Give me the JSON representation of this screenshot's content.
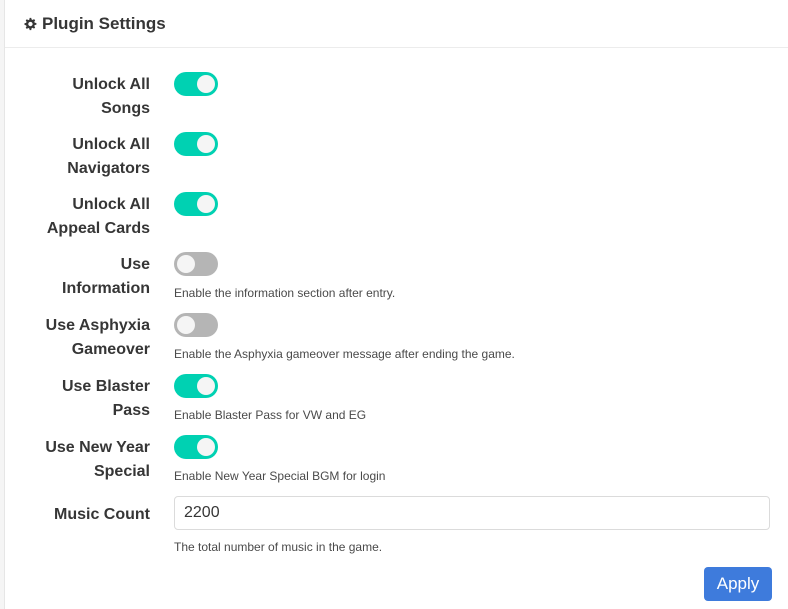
{
  "header": {
    "title": "Plugin Settings",
    "icon": "gear-icon"
  },
  "settings": [
    {
      "label_line1": "Unlock All",
      "label_line2": "Songs",
      "enabled": true,
      "help": ""
    },
    {
      "label_line1": "Unlock All",
      "label_line2": "Navigators",
      "enabled": true,
      "help": ""
    },
    {
      "label_line1": "Unlock All",
      "label_line2": "Appeal Cards",
      "enabled": true,
      "help": ""
    },
    {
      "label_line1": "Use",
      "label_line2": "Information",
      "enabled": false,
      "help": "Enable the information section after entry."
    },
    {
      "label_line1": "Use Asphyxia",
      "label_line2": "Gameover",
      "enabled": false,
      "help": "Enable the Asphyxia gameover message after ending the game."
    },
    {
      "label_line1": "Use Blaster",
      "label_line2": "Pass",
      "enabled": true,
      "help": "Enable Blaster Pass for VW and EG"
    },
    {
      "label_line1": "Use New Year",
      "label_line2": "Special",
      "enabled": true,
      "help": "Enable New Year Special BGM for login"
    }
  ],
  "music_count": {
    "label": "Music Count",
    "value": "2200",
    "help": "The total number of music in the game."
  },
  "apply_label": "Apply",
  "colors": {
    "toggle_on": "#00d1b2",
    "toggle_off": "#b5b5b5",
    "apply": "#3e7bdc"
  }
}
